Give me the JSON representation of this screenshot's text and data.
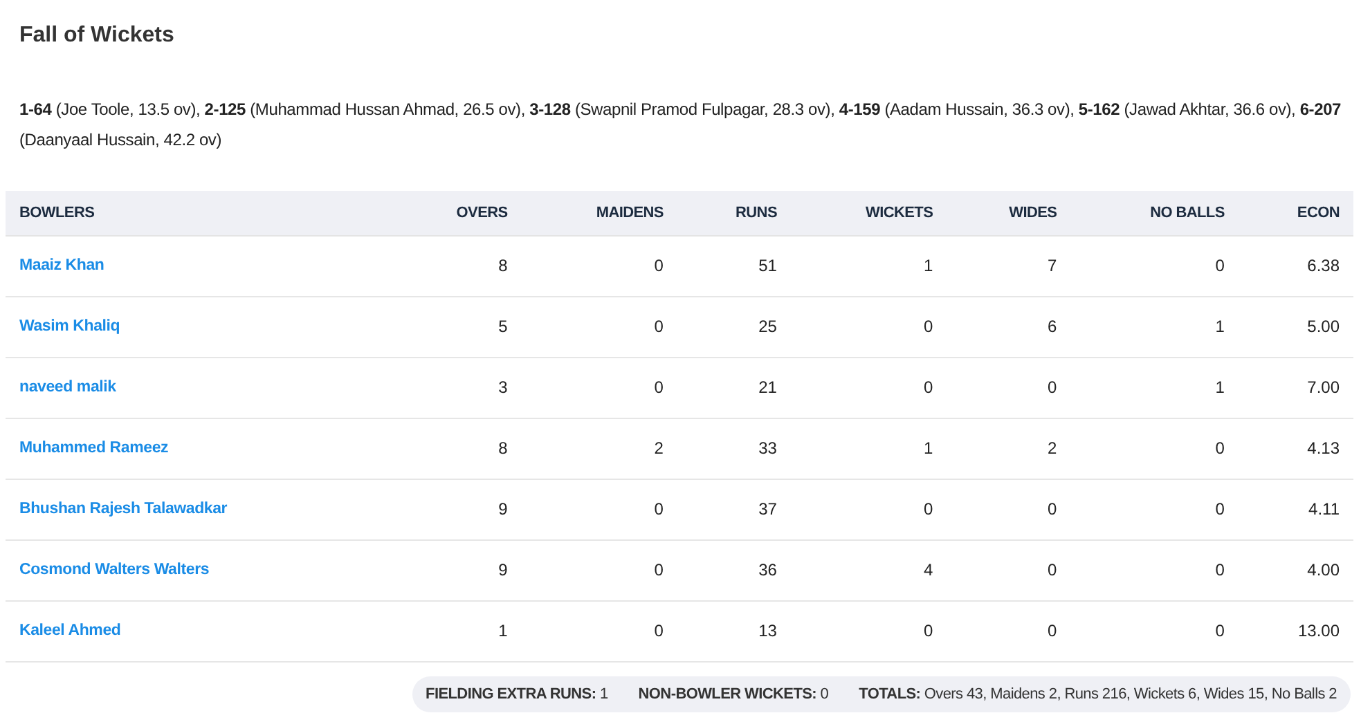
{
  "section_title": "Fall of Wickets",
  "fall_of_wickets": "**1-64** (Joe Toole, 13.5 ov), **2-125** (Muhammad Hussan Ahmad, 26.5 ov), **3-128** (Swapnil Pramod Fulpagar, 28.3 ov), **4-159** (Aadam Hussain, 36.3 ov), **5-162** (Jawad Akhtar, 36.6 ov), **6-207** (Daanyaal Hussain, 42.2 ov)",
  "table": {
    "columns": [
      "BOWLERS",
      "OVERS",
      "MAIDENS",
      "RUNS",
      "WICKETS",
      "WIDES",
      "NO BALLS",
      "ECON"
    ],
    "rows": [
      {
        "cells": [
          "Maaiz Khan",
          "8",
          "0",
          "51",
          "1",
          "7",
          "0",
          "6.38"
        ]
      },
      {
        "cells": [
          "Wasim Khaliq",
          "5",
          "0",
          "25",
          "0",
          "6",
          "1",
          "5.00"
        ]
      },
      {
        "cells": [
          "naveed malik",
          "3",
          "0",
          "21",
          "0",
          "0",
          "1",
          "7.00"
        ]
      },
      {
        "cells": [
          "Muhammed Rameez",
          "8",
          "2",
          "33",
          "1",
          "2",
          "0",
          "4.13"
        ]
      },
      {
        "cells": [
          "Bhushan Rajesh Talawadkar",
          "9",
          "0",
          "37",
          "0",
          "0",
          "0",
          "4.11"
        ]
      },
      {
        "cells": [
          "Cosmond Walters Walters",
          "9",
          "0",
          "36",
          "4",
          "0",
          "0",
          "4.00"
        ]
      },
      {
        "cells": [
          "Kaleel Ahmed",
          "1",
          "0",
          "13",
          "0",
          "0",
          "0",
          "13.00"
        ]
      }
    ]
  },
  "summary": [
    "**FIELDING EXTRA RUNS:** 1",
    "**NON-BOWLER WICKETS:** 0",
    "**TOTALS:** Overs 43, Maidens 2, Runs 216, Wickets 6, Wides 15, No Balls 2"
  ]
}
